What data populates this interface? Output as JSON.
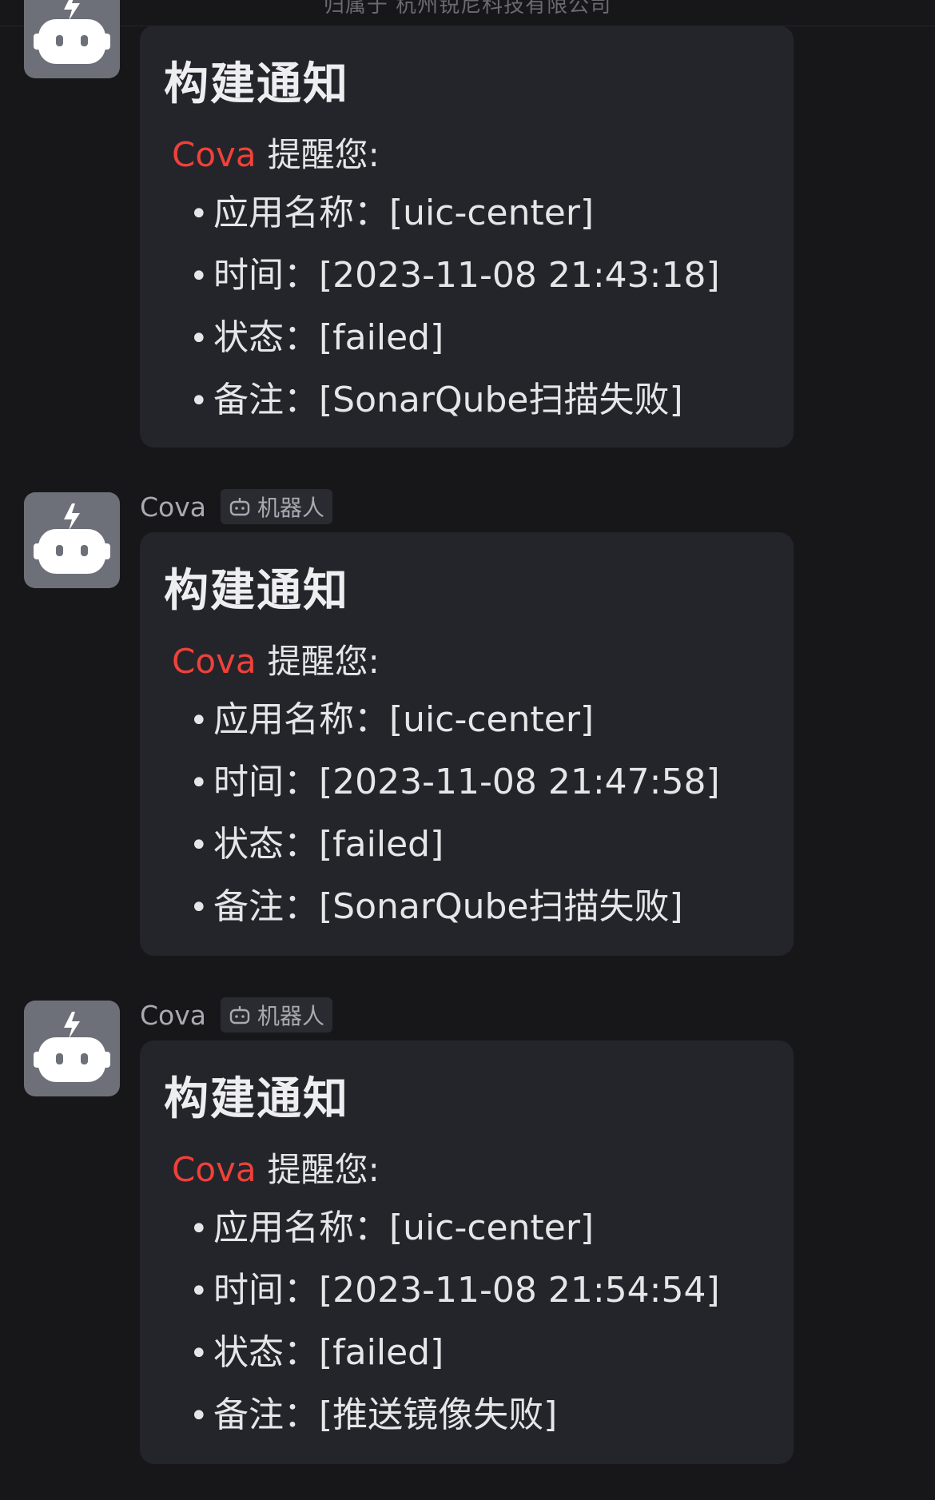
{
  "header": {
    "subtitle": "归属于 杭州锐尼科技有限公司"
  },
  "colors": {
    "background": "#17171a",
    "card": "#24252b",
    "mention": "#f0413a",
    "avatar": "#6d7079"
  },
  "messages": [
    {
      "sender": "",
      "tag": "",
      "title": "构建通知",
      "mention": "Cova",
      "mention_suffix": "提醒您:",
      "items": [
        "应用名称：[uic-center]",
        "时间：[2023-11-08 21:43:18]",
        "状态：[failed]",
        "备注：[SonarQube扫描失败]"
      ]
    },
    {
      "sender": "Cova",
      "tag": "机器人",
      "title": "构建通知",
      "mention": "Cova",
      "mention_suffix": "提醒您:",
      "items": [
        "应用名称：[uic-center]",
        "时间：[2023-11-08 21:47:58]",
        "状态：[failed]",
        "备注：[SonarQube扫描失败]"
      ]
    },
    {
      "sender": "Cova",
      "tag": "机器人",
      "title": "构建通知",
      "mention": "Cova",
      "mention_suffix": "提醒您:",
      "items": [
        "应用名称：[uic-center]",
        "时间：[2023-11-08 21:54:54]",
        "状态：[failed]",
        "备注：[推送镜像失败]"
      ]
    }
  ]
}
